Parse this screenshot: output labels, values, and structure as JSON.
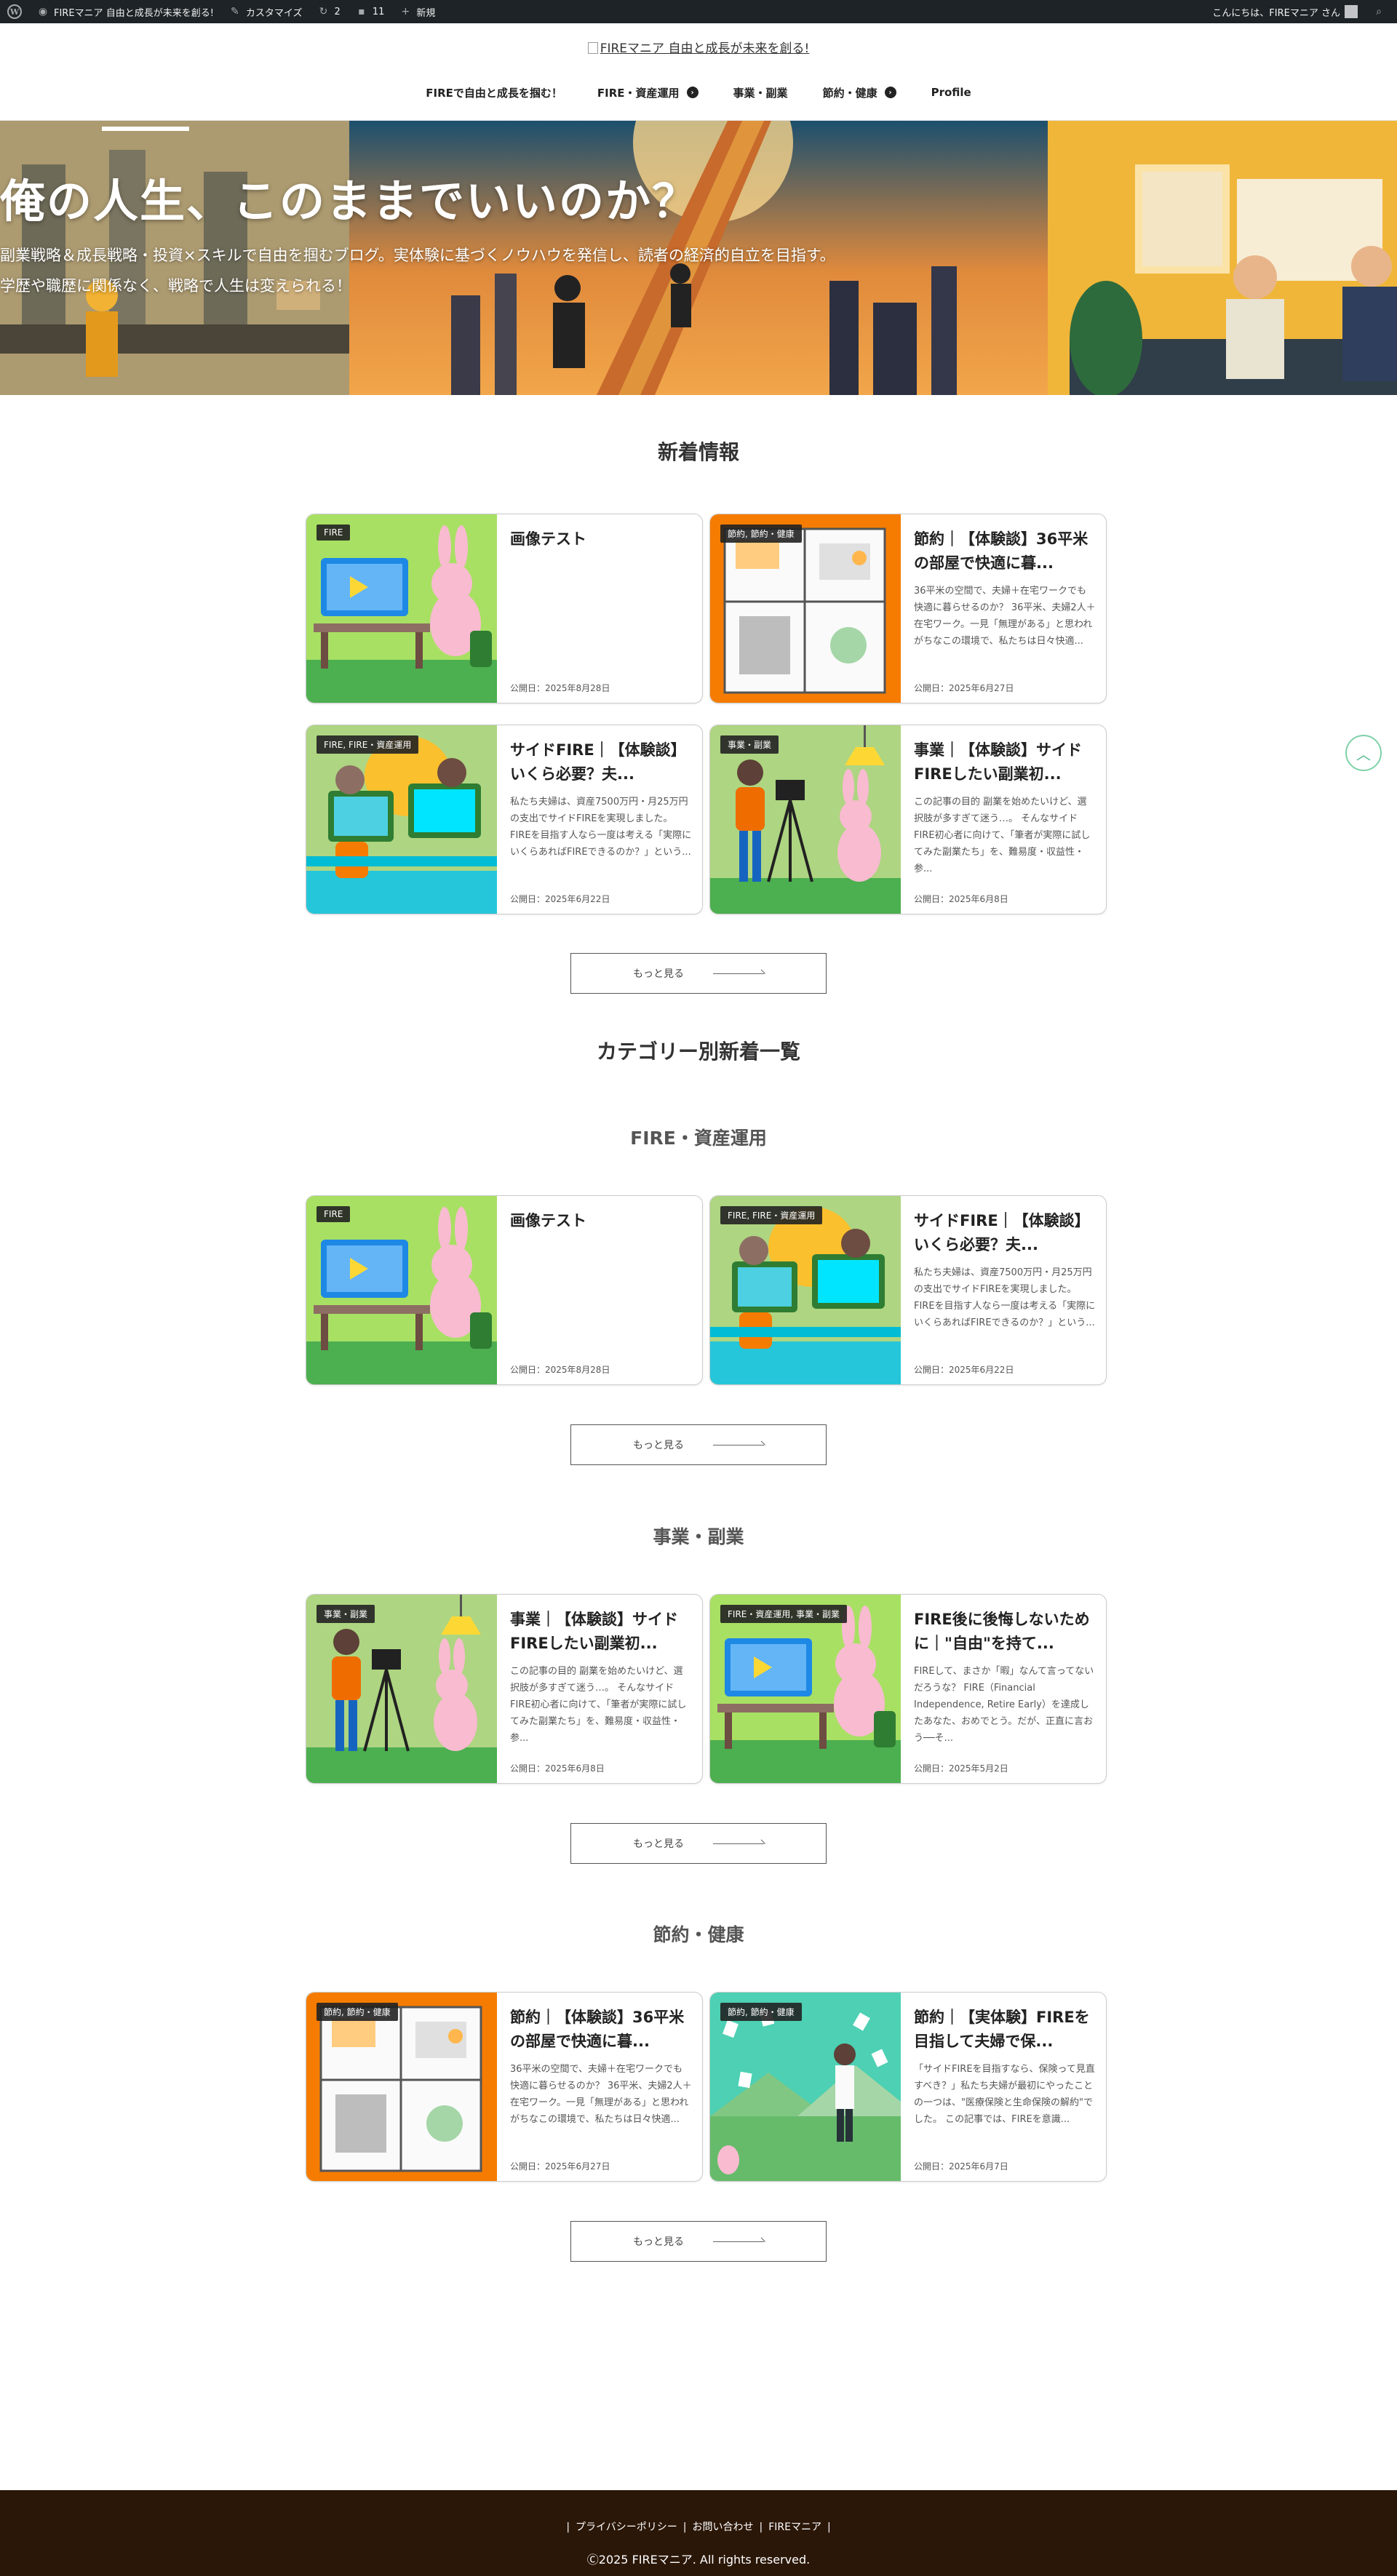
{
  "adminbar": {
    "site_name": "FIREマニア 自由と成長が未来を創る!",
    "customize": "カスタマイズ",
    "updates": "2",
    "comments": "11",
    "new": "新規",
    "greeting": "こんにちは、FIREマニア さん"
  },
  "header": {
    "logo_alt": "FIREマニア 自由と成長が未来を創る!",
    "nav": [
      {
        "label": "FIREで自由と成長を掴む！"
      },
      {
        "label": "FIRE・資産運用"
      },
      {
        "label": "事業・副業"
      },
      {
        "label": "節約・健康"
      },
      {
        "label": "Profile"
      }
    ]
  },
  "hero": {
    "title": "俺の人生、このままでいいのか？",
    "desc": "副業戦略＆成長戦略・投資×スキルで自由を掴むブログ。実体験に基づくノウハウを発信し、読者の経済的自立を目指す。学歴や職歴に関係なく、戦略で人生は変えられる！"
  },
  "sections": {
    "latest": "新着情報",
    "by_category": "カテゴリー別新着一覧",
    "fire": "FIRE・資産運用",
    "business": "事業・副業",
    "saving": "節約・健康"
  },
  "more_label": "もっと見る",
  "cards": {
    "latest": [
      {
        "tag": "FIRE",
        "title": "画像テスト",
        "excerpt": "",
        "date": "公開日：2025年8月28日"
      },
      {
        "tag": "節約, 節約・健康",
        "title": "節約｜【体験談】36平米の部屋で快適に暮...",
        "excerpt": "36平米の空間で、夫婦＋在宅ワークでも快適に暮らせるのか？ 36平米、夫婦2人＋在宅ワーク。一見「無理がある」と思われがちなこの環境で、私たちは日々快適...",
        "date": "公開日：2025年6月27日"
      },
      {
        "tag": "FIRE, FIRE・資産運用",
        "title": "サイドFIRE｜【体験談】いくら必要？夫...",
        "excerpt": "私たち夫婦は、資産7500万円・月25万円の支出でサイドFIREを実現しました。 FIREを目指す人なら一度は考える「実際にいくらあればFIREできるのか？」という...",
        "date": "公開日：2025年6月22日"
      },
      {
        "tag": "事業・副業",
        "title": "事業｜【体験談】サイドFIREしたい副業初...",
        "excerpt": "この記事の目的 副業を始めたいけど、選択肢が多すぎて迷う…。 そんなサイドFIRE初心者に向けて、「筆者が実際に試してみた副業たち」を、難易度・収益性・参...",
        "date": "公開日：2025年6月8日"
      }
    ],
    "fire": [
      {
        "tag": "FIRE",
        "title": "画像テスト",
        "excerpt": "",
        "date": "公開日：2025年8月28日"
      },
      {
        "tag": "FIRE, FIRE・資産運用",
        "title": "サイドFIRE｜【体験談】いくら必要？夫...",
        "excerpt": "私たち夫婦は、資産7500万円・月25万円の支出でサイドFIREを実現しました。 FIREを目指す人なら一度は考える「実際にいくらあればFIREできるのか？」という...",
        "date": "公開日：2025年6月22日"
      }
    ],
    "business": [
      {
        "tag": "事業・副業",
        "title": "事業｜【体験談】サイドFIREしたい副業初...",
        "excerpt": "この記事の目的 副業を始めたいけど、選択肢が多すぎて迷う…。 そんなサイドFIRE初心者に向けて、「筆者が実際に試してみた副業たち」を、難易度・収益性・参...",
        "date": "公開日：2025年6月8日"
      },
      {
        "tag": "FIRE・資産運用, 事業・副業",
        "title": "FIRE後に後悔しないために｜\"自由\"を持て...",
        "excerpt": "FIREして、まさか「暇」なんて言ってないだろうな？ FIRE（Financial Independence, Retire Early）を達成したあなた、おめでとう。だが、正直に言おう──そ...",
        "date": "公開日：2025年5月2日"
      }
    ],
    "saving": [
      {
        "tag": "節約, 節約・健康",
        "title": "節約｜【体験談】36平米の部屋で快適に暮...",
        "excerpt": "36平米の空間で、夫婦＋在宅ワークでも快適に暮らせるのか？ 36平米、夫婦2人＋在宅ワーク。一見「無理がある」と思われがちなこの環境で、私たちは日々快適...",
        "date": "公開日：2025年6月27日"
      },
      {
        "tag": "節約, 節約・健康",
        "title": "節約｜【実体験】FIREを目指して夫婦で保...",
        "excerpt": "「サイドFIREを目指すなら、保険って見直すべき？」私たち夫婦が最初にやったことの一つは、\"医療保険と生命保険の解約\"でした。 この記事では、FIREを意識...",
        "date": "公開日：2025年6月7日"
      }
    ]
  },
  "footer": {
    "privacy": "プライバシーポリシー",
    "contact": "お問い合わせ",
    "site": "FIREマニア",
    "copyright": "Ⓒ2025 FIREマニア. All rights reserved."
  }
}
